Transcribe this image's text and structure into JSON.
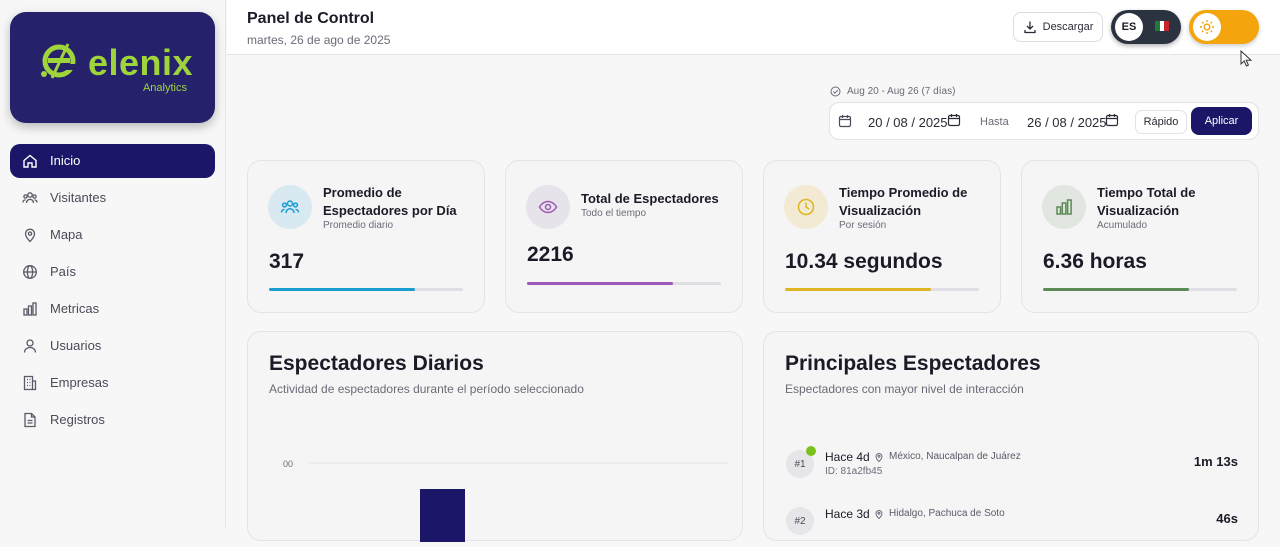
{
  "brand": {
    "name": "elenix",
    "sub": "Analytics",
    "color": "#9fd53a",
    "bg": "#25216b"
  },
  "sidebar": {
    "items": [
      {
        "label": "Inicio",
        "icon": "home-icon",
        "active": true
      },
      {
        "label": "Visitantes",
        "icon": "users-icon"
      },
      {
        "label": "Mapa",
        "icon": "map-pin-icon"
      },
      {
        "label": "País",
        "icon": "globe-icon"
      },
      {
        "label": "Metricas",
        "icon": "bar-chart-icon"
      },
      {
        "label": "Usuarios",
        "icon": "user-icon"
      },
      {
        "label": "Empresas",
        "icon": "building-icon"
      },
      {
        "label": "Registros",
        "icon": "file-icon"
      }
    ]
  },
  "header": {
    "title": "Panel de Control",
    "date": "martes, 26 de ago de 2025",
    "download_label": "Descargar",
    "lang": "ES"
  },
  "range": {
    "caption": "Aug 20 - Aug 26 (7 días)",
    "from": "20 / 08 / 2025",
    "to_label": "Hasta",
    "to": "26 / 08 / 2025",
    "quick_label": "Rápido",
    "apply_label": "Aplicar"
  },
  "kpis": [
    {
      "title": "Promedio de Espectadores por Día",
      "sub": "Promedio diario",
      "value": "317",
      "progress": 0.75,
      "color": "#1a9ecf",
      "icon": "users-icon"
    },
    {
      "title": "Total de Espectadores",
      "sub": "Todo el tiempo",
      "value": "2216",
      "progress": 0.75,
      "color": "#9b59b6",
      "icon": "eye-icon"
    },
    {
      "title": "Tiempo Promedio de Visualización",
      "sub": "Por sesión",
      "value": "10.34 segundos",
      "progress": 0.75,
      "color": "#e0b422",
      "icon": "clock-icon"
    },
    {
      "title": "Tiempo Total de Visualización",
      "sub": "Acumulado",
      "value": "6.36 horas",
      "progress": 0.75,
      "color": "#5b8a55",
      "icon": "bar-chart-icon"
    }
  ],
  "daily": {
    "title": "Espectadores Diarios",
    "subtitle": "Actividad de espectadores durante el período seleccionado",
    "axis_label": "00"
  },
  "top": {
    "title": "Principales Espectadores",
    "subtitle": "Espectadores con mayor nivel de interacción",
    "rows": [
      {
        "rank": "#1",
        "ago": "Hace 4d",
        "location": "México, Naucalpan de Juárez",
        "id": "ID: 81a2fb45",
        "duration": "1m 13s"
      },
      {
        "rank": "#2",
        "ago": "Hace 3d",
        "location": "Hidalgo, Pachuca de Soto",
        "id": "",
        "duration": "46s"
      }
    ]
  }
}
